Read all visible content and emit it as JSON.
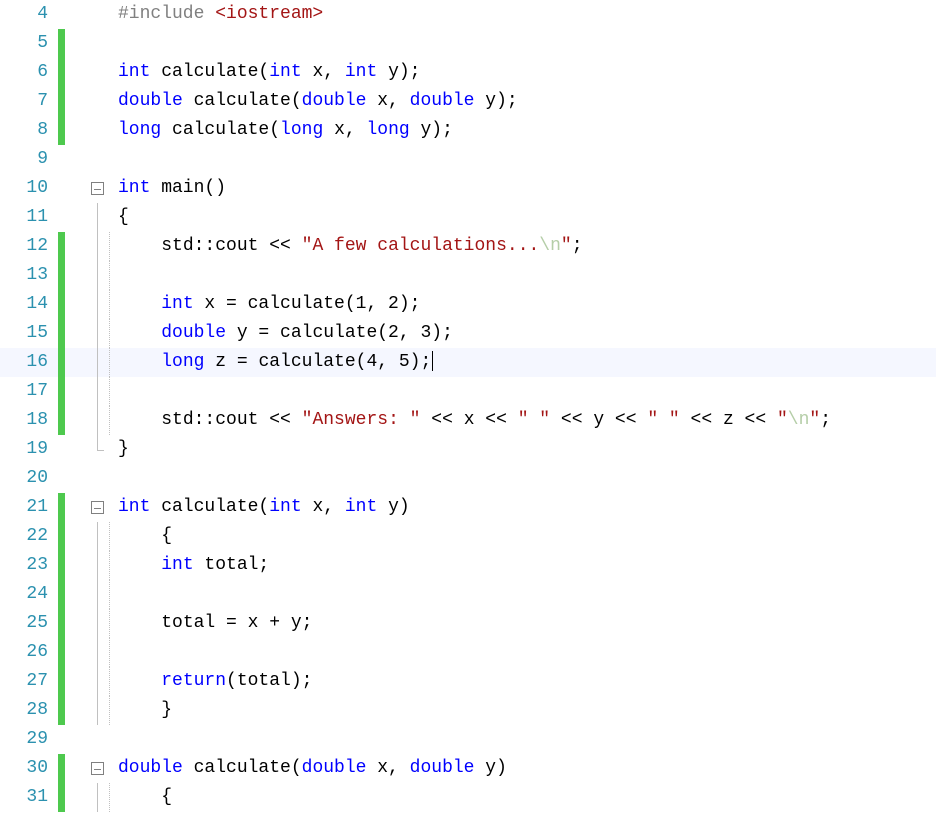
{
  "colors": {
    "line_number": "#2b91af",
    "change_bar": "#4EC94E",
    "keyword": "#0000ff",
    "preprocessor": "#808080",
    "string": "#a31515",
    "escape": "#b5cea8",
    "outline": "#808080"
  },
  "active_line": 16,
  "lines": [
    {
      "num": 4,
      "changebar": false,
      "outline": "none",
      "dotline": false,
      "tokens": [
        {
          "cls": "pp",
          "t": "#include "
        },
        {
          "cls": "hdr",
          "t": "<iostream>"
        }
      ]
    },
    {
      "num": 5,
      "changebar": true,
      "outline": "none",
      "dotline": false,
      "tokens": []
    },
    {
      "num": 6,
      "changebar": true,
      "outline": "none",
      "dotline": false,
      "tokens": [
        {
          "cls": "kw",
          "t": "int"
        },
        {
          "cls": "p",
          "t": " calculate("
        },
        {
          "cls": "kw",
          "t": "int"
        },
        {
          "cls": "p",
          "t": " x, "
        },
        {
          "cls": "kw",
          "t": "int"
        },
        {
          "cls": "p",
          "t": " y);"
        }
      ]
    },
    {
      "num": 7,
      "changebar": true,
      "outline": "none",
      "dotline": false,
      "tokens": [
        {
          "cls": "kw",
          "t": "double"
        },
        {
          "cls": "p",
          "t": " calculate("
        },
        {
          "cls": "kw",
          "t": "double"
        },
        {
          "cls": "p",
          "t": " x, "
        },
        {
          "cls": "kw",
          "t": "double"
        },
        {
          "cls": "p",
          "t": " y);"
        }
      ]
    },
    {
      "num": 8,
      "changebar": true,
      "outline": "none",
      "dotline": false,
      "tokens": [
        {
          "cls": "kw",
          "t": "long"
        },
        {
          "cls": "p",
          "t": " calculate("
        },
        {
          "cls": "kw",
          "t": "long"
        },
        {
          "cls": "p",
          "t": " x, "
        },
        {
          "cls": "kw",
          "t": "long"
        },
        {
          "cls": "p",
          "t": " y);"
        }
      ]
    },
    {
      "num": 9,
      "changebar": false,
      "outline": "none",
      "dotline": false,
      "tokens": []
    },
    {
      "num": 10,
      "changebar": false,
      "outline": "box",
      "dotline": false,
      "tokens": [
        {
          "cls": "kw",
          "t": "int"
        },
        {
          "cls": "p",
          "t": " main()"
        }
      ]
    },
    {
      "num": 11,
      "changebar": false,
      "outline": "line",
      "dotline": false,
      "tokens": [
        {
          "cls": "p",
          "t": "{"
        }
      ]
    },
    {
      "num": 12,
      "changebar": true,
      "outline": "line",
      "dotline": true,
      "indent": "    ",
      "tokens": [
        {
          "cls": "p",
          "t": "std::cout << "
        },
        {
          "cls": "str",
          "t": "\"A few calculations..."
        },
        {
          "cls": "esc",
          "t": "\\n"
        },
        {
          "cls": "str",
          "t": "\""
        },
        {
          "cls": "p",
          "t": ";"
        }
      ]
    },
    {
      "num": 13,
      "changebar": true,
      "outline": "line",
      "dotline": true,
      "indent": "    ",
      "tokens": []
    },
    {
      "num": 14,
      "changebar": true,
      "outline": "line",
      "dotline": true,
      "indent": "    ",
      "tokens": [
        {
          "cls": "kw",
          "t": "int"
        },
        {
          "cls": "p",
          "t": " x = calculate(1, 2);"
        }
      ]
    },
    {
      "num": 15,
      "changebar": true,
      "outline": "line",
      "dotline": true,
      "indent": "    ",
      "tokens": [
        {
          "cls": "kw",
          "t": "double"
        },
        {
          "cls": "p",
          "t": " y = calculate(2, 3);"
        }
      ]
    },
    {
      "num": 16,
      "changebar": true,
      "outline": "line",
      "dotline": true,
      "indent": "    ",
      "highlight": true,
      "tokens": [
        {
          "cls": "kw",
          "t": "long"
        },
        {
          "cls": "p",
          "t": " z = calculate(4, 5);"
        }
      ],
      "cursor_after": true
    },
    {
      "num": 17,
      "changebar": true,
      "outline": "line",
      "dotline": true,
      "indent": "    ",
      "tokens": []
    },
    {
      "num": 18,
      "changebar": true,
      "outline": "line",
      "dotline": true,
      "indent": "    ",
      "tokens": [
        {
          "cls": "p",
          "t": "std::cout << "
        },
        {
          "cls": "str",
          "t": "\"Answers: \""
        },
        {
          "cls": "p",
          "t": " << x << "
        },
        {
          "cls": "str",
          "t": "\" \""
        },
        {
          "cls": "p",
          "t": " << y << "
        },
        {
          "cls": "str",
          "t": "\" \""
        },
        {
          "cls": "p",
          "t": " << z << "
        },
        {
          "cls": "str",
          "t": "\""
        },
        {
          "cls": "esc",
          "t": "\\n"
        },
        {
          "cls": "str",
          "t": "\""
        },
        {
          "cls": "p",
          "t": ";"
        }
      ]
    },
    {
      "num": 19,
      "changebar": false,
      "outline": "end",
      "dotline": false,
      "tokens": [
        {
          "cls": "p",
          "t": "}"
        }
      ]
    },
    {
      "num": 20,
      "changebar": false,
      "outline": "none",
      "dotline": false,
      "tokens": []
    },
    {
      "num": 21,
      "changebar": true,
      "outline": "box",
      "dotline": false,
      "tokens": [
        {
          "cls": "kw",
          "t": "int"
        },
        {
          "cls": "p",
          "t": " calculate("
        },
        {
          "cls": "kw",
          "t": "int"
        },
        {
          "cls": "p",
          "t": " x, "
        },
        {
          "cls": "kw",
          "t": "int"
        },
        {
          "cls": "p",
          "t": " y)"
        }
      ]
    },
    {
      "num": 22,
      "changebar": true,
      "outline": "line",
      "dotline": true,
      "indent": "    ",
      "tokens": [
        {
          "cls": "p",
          "t": "{"
        }
      ]
    },
    {
      "num": 23,
      "changebar": true,
      "outline": "line",
      "dotline": true,
      "indent": "    ",
      "tokens": [
        {
          "cls": "kw",
          "t": "int"
        },
        {
          "cls": "p",
          "t": " total;"
        }
      ]
    },
    {
      "num": 24,
      "changebar": true,
      "outline": "line",
      "dotline": true,
      "indent": "    ",
      "tokens": []
    },
    {
      "num": 25,
      "changebar": true,
      "outline": "line",
      "dotline": true,
      "indent": "    ",
      "tokens": [
        {
          "cls": "p",
          "t": "total = x + y;"
        }
      ]
    },
    {
      "num": 26,
      "changebar": true,
      "outline": "line",
      "dotline": true,
      "indent": "    ",
      "tokens": []
    },
    {
      "num": 27,
      "changebar": true,
      "outline": "line",
      "dotline": true,
      "indent": "    ",
      "tokens": [
        {
          "cls": "kw",
          "t": "return"
        },
        {
          "cls": "p",
          "t": "(total);"
        }
      ]
    },
    {
      "num": 28,
      "changebar": true,
      "outline": "line",
      "dotline": true,
      "indent": "    ",
      "tokens": [
        {
          "cls": "p",
          "t": "}"
        }
      ]
    },
    {
      "num": 29,
      "changebar": false,
      "outline": "none",
      "dotline": false,
      "tokens": []
    },
    {
      "num": 30,
      "changebar": true,
      "outline": "box",
      "dotline": false,
      "tokens": [
        {
          "cls": "kw",
          "t": "double"
        },
        {
          "cls": "p",
          "t": " calculate("
        },
        {
          "cls": "kw",
          "t": "double"
        },
        {
          "cls": "p",
          "t": " x, "
        },
        {
          "cls": "kw",
          "t": "double"
        },
        {
          "cls": "p",
          "t": " y)"
        }
      ]
    },
    {
      "num": 31,
      "changebar": true,
      "outline": "line",
      "dotline": true,
      "indent": "    ",
      "tokens": [
        {
          "cls": "p",
          "t": "{"
        }
      ]
    }
  ]
}
